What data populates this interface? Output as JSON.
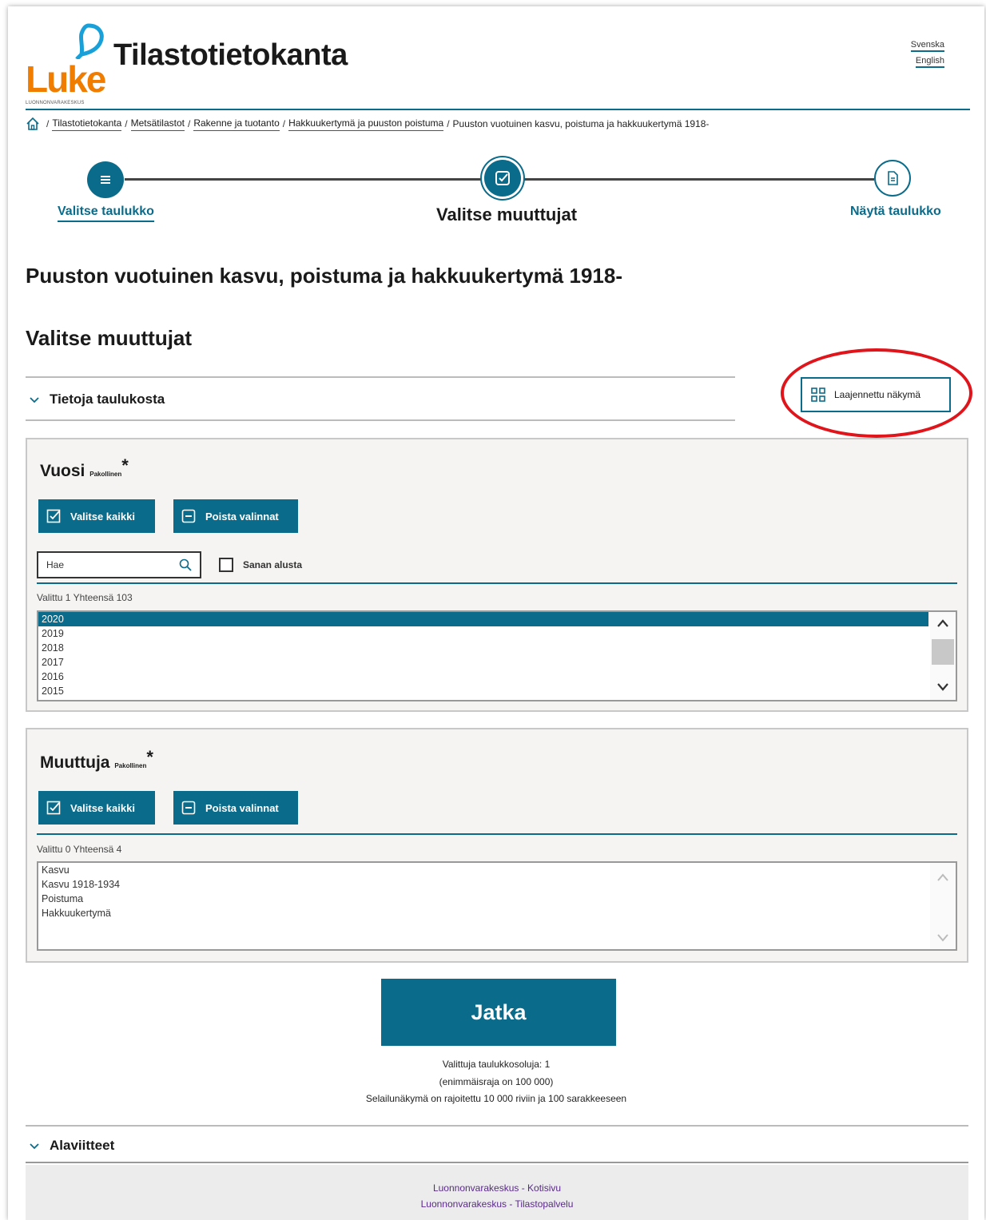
{
  "header": {
    "logo_text": "Luke",
    "logo_sub": "LUONNONVARAKESKUS",
    "site_title": "Tilastotietokanta",
    "lang_sv": "Svenska",
    "lang_en": "English"
  },
  "breadcrumb": {
    "items": [
      "Tilastotietokanta",
      "Metsätilastot",
      "Rakenne ja tuotanto",
      "Hakkuukertymä ja puuston poistuma"
    ],
    "current": "Puuston vuotuinen kasvu, poistuma ja hakkuukertymä 1918-"
  },
  "stepper": {
    "step1": "Valitse taulukko",
    "step2": "Valitse muuttujat",
    "step3": "Näytä taulukko"
  },
  "page_title": "Puuston vuotuinen kasvu, poistuma ja hakkuukertymä 1918-",
  "section_title": "Valitse muuttujat",
  "table_info_toggle": "Tietoja taulukosta",
  "expanded_view_label": "Laajennettu näkymä",
  "vuosi": {
    "title": "Vuosi",
    "required": "Pakollinen",
    "select_all": "Valitse kaikki",
    "clear": "Poista valinnat",
    "search_placeholder": "Hae",
    "checkbox_label": "Sanan alusta",
    "count": "Valittu 1 Yhteensä 103",
    "options": [
      "2020",
      "2019",
      "2018",
      "2017",
      "2016",
      "2015"
    ]
  },
  "muuttuja": {
    "title": "Muuttuja",
    "required": "Pakollinen",
    "select_all": "Valitse kaikki",
    "clear": "Poista valinnat",
    "count": "Valittu 0 Yhteensä 4",
    "options": [
      "Kasvu",
      "Kasvu 1918-1934",
      "Poistuma",
      "Hakkuukertymä"
    ]
  },
  "continue_label": "Jatka",
  "info": {
    "line1": "Valittuja taulukkosoluja:  1",
    "line2": "(enimmäisraja on 100 000)",
    "line3": "Selailunäkymä on rajoitettu 10 000 riviin ja 100 sarakkeeseen"
  },
  "footnotes_toggle": "Alaviitteet",
  "footer": {
    "link1": "Luonnonvarakeskus - Kotisivu",
    "link2": "Luonnonvarakeskus - Tilastopalvelu"
  },
  "colors": {
    "accent": "#0b6b8a",
    "logo_orange": "#f07d00",
    "logo_blue": "#1aa0d8",
    "highlight_red": "#e0141b"
  }
}
